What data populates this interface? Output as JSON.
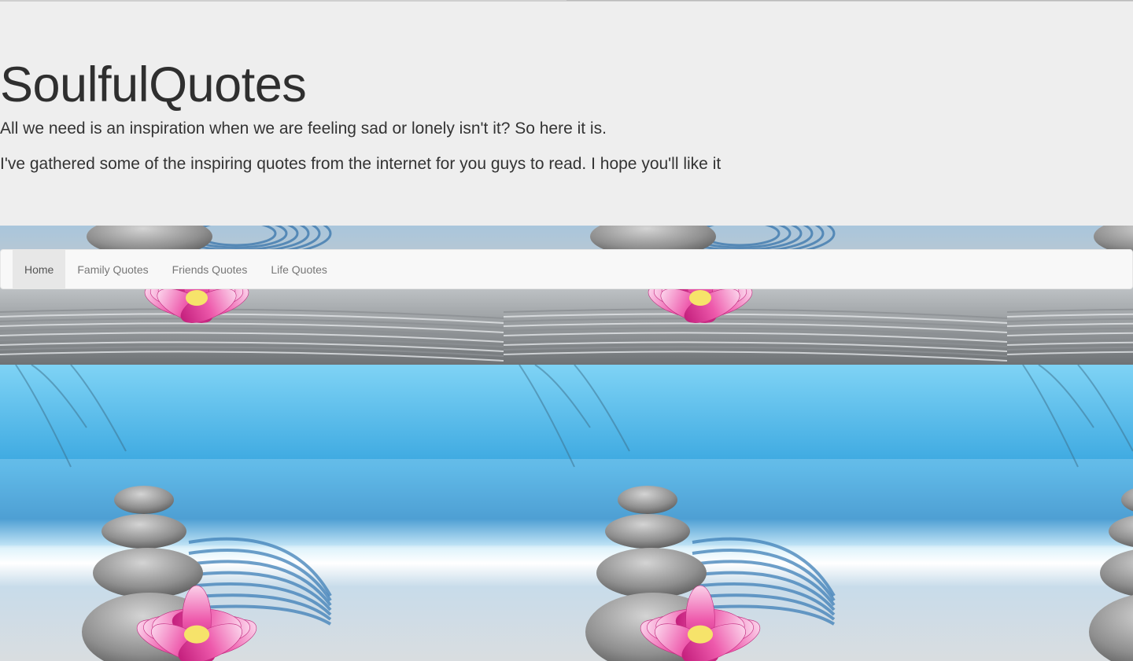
{
  "header": {
    "title": "SoulfulQuotes",
    "lines": [
      "All we need is an inspiration when we are feeling sad or lonely isn't it? So here it is.",
      "I've gathered some of the inspiring quotes from the internet for you guys to read. I hope you'll like it"
    ]
  },
  "nav": {
    "items": [
      {
        "label": "Home",
        "active": true
      },
      {
        "label": "Family Quotes",
        "active": false
      },
      {
        "label": "Friends Quotes",
        "active": false
      },
      {
        "label": "Life Quotes",
        "active": false
      }
    ]
  },
  "colors": {
    "jumbotron_bg": "#eeeeee",
    "navbar_bg": "#f8f8f8",
    "active_nav_bg": "#e7e7e7",
    "lotus_pink": "#e8489e",
    "sky_blue": "#2f8fd0"
  },
  "background_image": "zen-stones-lotus-icon"
}
